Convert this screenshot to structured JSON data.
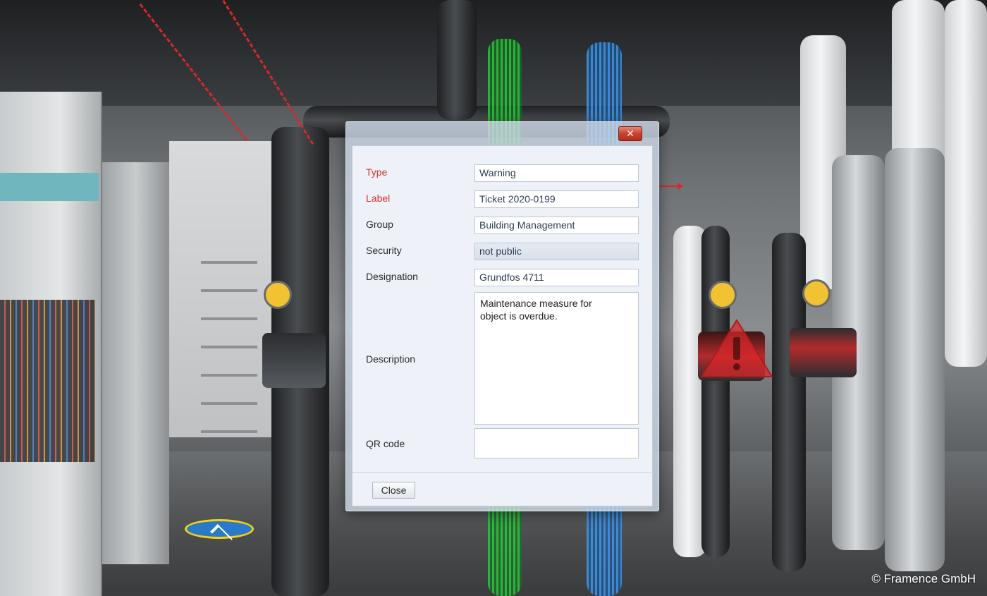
{
  "dialog": {
    "close_glyph": "✕",
    "fields": {
      "type": {
        "label": "Type",
        "value": "Warning",
        "required": true
      },
      "label": {
        "label": "Label",
        "value": "Ticket 2020-0199",
        "required": true
      },
      "group": {
        "label": "Group",
        "value": "Building Management",
        "required": false
      },
      "security": {
        "label": "Security",
        "value": "not public",
        "required": false
      },
      "designation": {
        "label": "Designation",
        "value": "Grundfos 4711",
        "required": false
      },
      "description": {
        "label": "Description",
        "value": "Maintenance measure for object is overdue.",
        "required": false
      },
      "qr_code": {
        "label": "QR code",
        "value": "",
        "required": false
      }
    },
    "close_button_label": "Close"
  },
  "scene": {
    "copyright": "© Framence GmbH",
    "warning_marker_icon": "warning-triangle-icon",
    "warning_color": "#d9272a"
  }
}
